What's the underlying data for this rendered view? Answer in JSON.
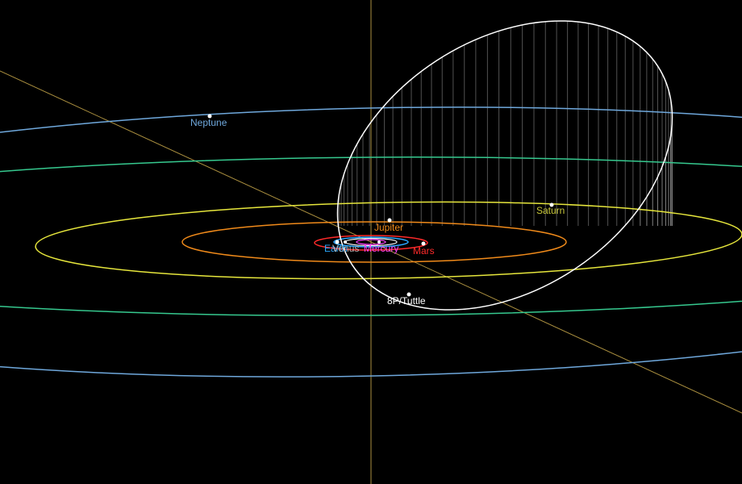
{
  "colors": {
    "background": "#000000",
    "neptune": "#6fa8dc",
    "uranus": "#36c98f",
    "saturn": "#e6e63c",
    "jupiter": "#f08a1a",
    "mars": "#ff2a2a",
    "earth": "#2aa8ff",
    "venus": "#ffffff",
    "mercury": "#ff44ff",
    "comet": "#ffffff",
    "axis": "#c8a84a",
    "label_bodies": "#cccccc"
  },
  "bodies": [
    {
      "id": "neptune",
      "label": "Neptune"
    },
    {
      "id": "uranus",
      "label": ""
    },
    {
      "id": "saturn",
      "label": "Saturn"
    },
    {
      "id": "jupiter",
      "label": "Jupiter"
    },
    {
      "id": "mars",
      "label": "Mars"
    },
    {
      "id": "earth",
      "label": "Earth"
    },
    {
      "id": "venus",
      "label": "Venus"
    },
    {
      "id": "mercury",
      "label": "Mercury"
    },
    {
      "id": "comet",
      "label": "8P/Tuttle"
    }
  ]
}
